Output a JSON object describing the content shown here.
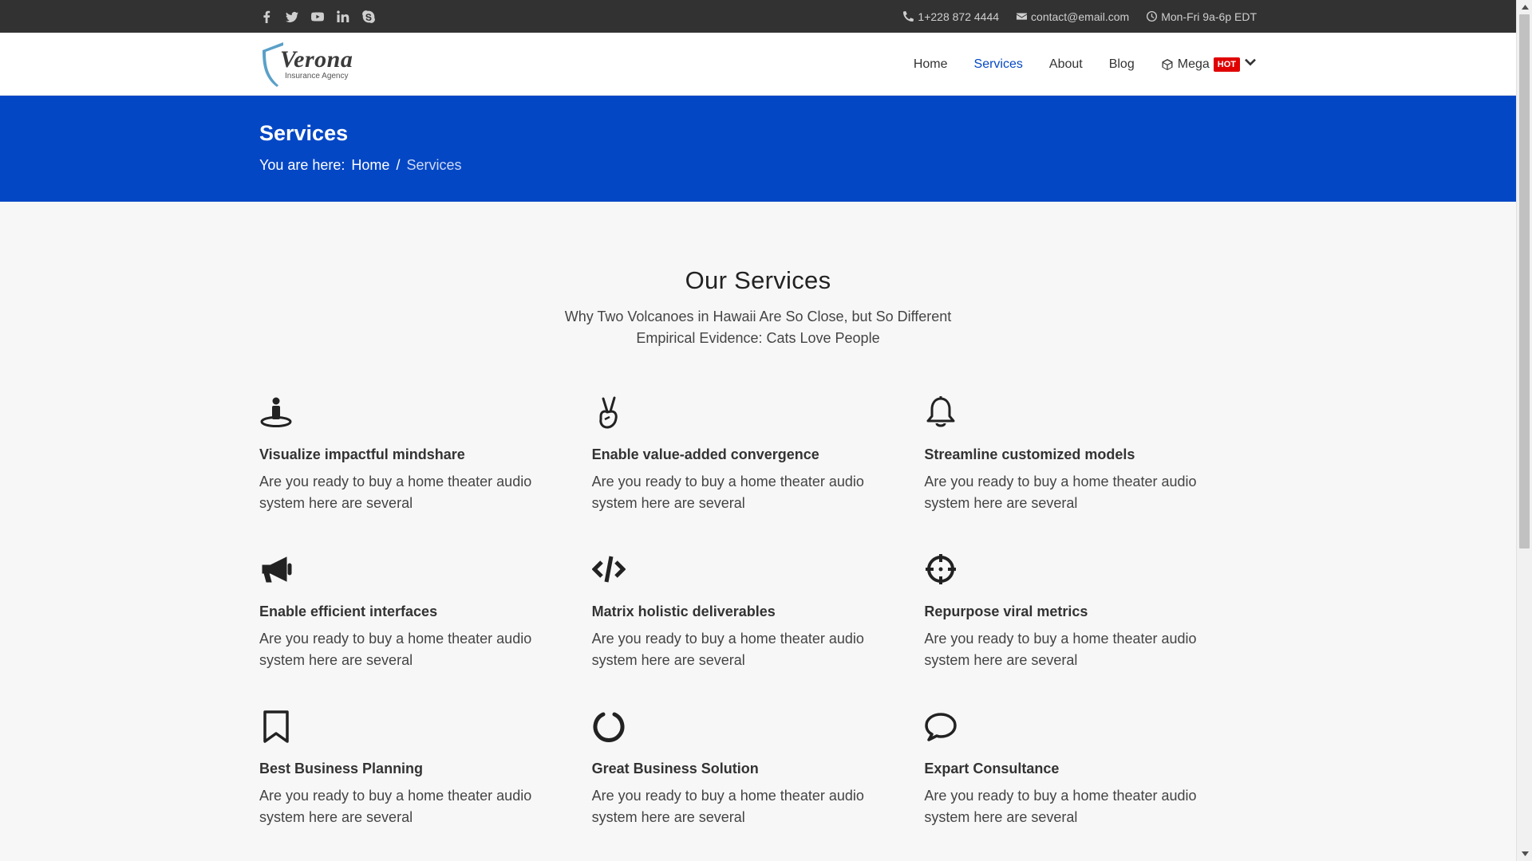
{
  "topbar": {
    "social": [
      "facebook-icon",
      "twitter-icon",
      "youtube-icon",
      "linkedin-icon",
      "skype-icon"
    ],
    "phone": "1+228 872 4444",
    "email": "contact@email.com",
    "hours": "Mon-Fri 9a-6p EDT"
  },
  "header": {
    "logo_name": "Verona",
    "logo_sub": "Insurance Agency",
    "nav": {
      "home": "Home",
      "services": "Services",
      "about": "About",
      "blog": "Blog",
      "mega": "Mega",
      "hot": "HOT"
    }
  },
  "banner": {
    "title": "Services",
    "you_are_here": "You are here:",
    "crumb_home": "Home",
    "separator": "/",
    "crumb_current": "Services"
  },
  "section": {
    "title": "Our Services",
    "sub1": "Why Two Volcanoes in Hawaii Are So Close, but So Different",
    "sub2": "Empirical Evidence: Cats Love People"
  },
  "cards": [
    {
      "title": "Visualize impactful mindshare",
      "text": "Are you ready to buy a home theater audio system here are several",
      "icon": "person-pin-icon"
    },
    {
      "title": "Enable value-added convergence",
      "text": "Are you ready to buy a home theater audio system here are several",
      "icon": "peace-hand-icon"
    },
    {
      "title": "Streamline customized models",
      "text": "Are you ready to buy a home theater audio system here are several",
      "icon": "bell-icon"
    },
    {
      "title": "Enable efficient interfaces",
      "text": "Are you ready to buy a home theater audio system here are several",
      "icon": "megaphone-icon"
    },
    {
      "title": "Matrix holistic deliverables",
      "text": "Are you ready to buy a home theater audio system here are several",
      "icon": "code-icon"
    },
    {
      "title": "Repurpose viral metrics",
      "text": "Are you ready to buy a home theater audio system here are several",
      "icon": "crosshair-icon"
    },
    {
      "title": "Best Business Planning",
      "text": "Are you ready to buy a home theater audio system here are several",
      "icon": "bookmark-icon"
    },
    {
      "title": "Great Business Solution",
      "text": "Are you ready to buy a home theater audio system here are several",
      "icon": "circle-notch-icon"
    },
    {
      "title": "Expart Consultance",
      "text": "Are you ready to buy a home theater audio system here are several",
      "icon": "chat-bubble-icon"
    }
  ],
  "colors": {
    "topbar": "#323232",
    "brand_blue": "#0447c5",
    "hot_badge": "#e00000",
    "page_bg": "#f7f7f7"
  }
}
